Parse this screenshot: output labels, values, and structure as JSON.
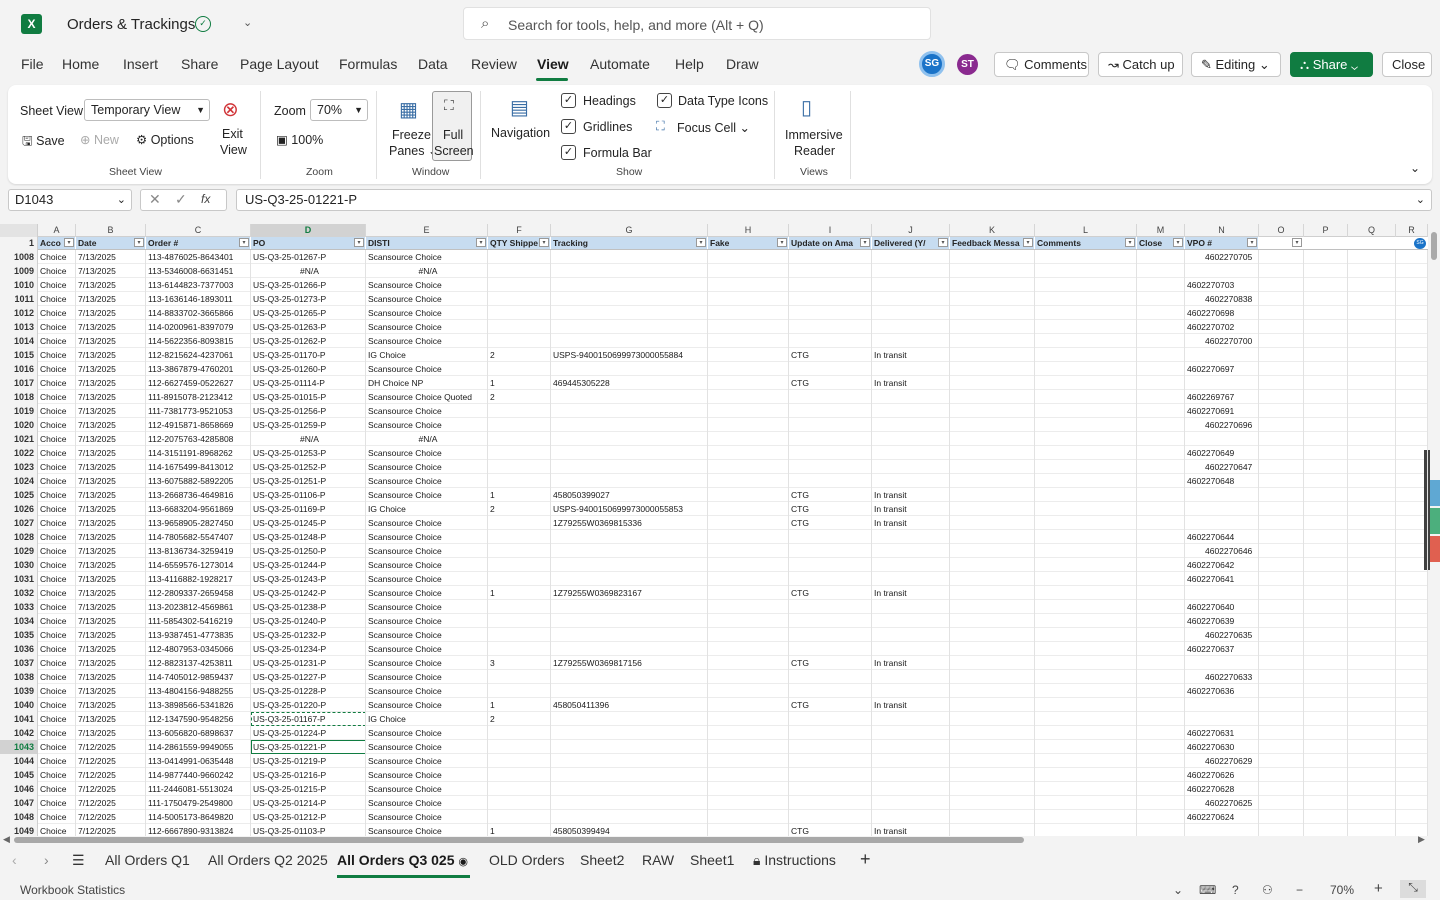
{
  "app": {
    "title": "Orders & Trackings",
    "logo": "X"
  },
  "search": {
    "placeholder": "Search for tools, help, and more (Alt + Q)"
  },
  "menu": [
    "File",
    "Home",
    "Insert",
    "Share",
    "Page Layout",
    "Formulas",
    "Data",
    "Review",
    "View",
    "Automate",
    "Help",
    "Draw"
  ],
  "active_menu": "View",
  "avatars": [
    "SG",
    "ST"
  ],
  "buttons": {
    "comments": "Comments",
    "catchup": "Catch up",
    "editing": "Editing",
    "share": "Share",
    "close": "Close"
  },
  "ribbon": {
    "sheet_view_label": "Sheet View",
    "sheet_view_value": "Temporary View",
    "save": "Save",
    "new": "New",
    "options": "Options",
    "exit": "Exit",
    "exit2": "View",
    "group_sheet_view": "Sheet View",
    "zoom_label": "Zoom",
    "zoom_value": "70%",
    "zoom_100": "100%",
    "group_zoom": "Zoom",
    "freeze": "Freeze",
    "freeze2": "Panes",
    "full": "Full",
    "full2": "Screen",
    "group_window": "Window",
    "navigation": "Navigation",
    "headings": "Headings",
    "gridlines": "Gridlines",
    "formula_bar": "Formula Bar",
    "data_type_icons": "Data Type Icons",
    "focus_cell": "Focus Cell",
    "group_show": "Show",
    "immersive": "Immersive",
    "reader": "Reader",
    "group_views": "Views"
  },
  "formula": {
    "name_box": "D1043",
    "value": "US-Q3-25-01221-P"
  },
  "columns": [
    "A",
    "B",
    "C",
    "D",
    "E",
    "F",
    "G",
    "H",
    "I",
    "J",
    "K",
    "L",
    "M",
    "N",
    "O",
    "P",
    "Q",
    "R"
  ],
  "header_cells": [
    "Acco",
    "Date",
    "Order #",
    "PO",
    "DISTI",
    "QTY Shippe",
    "Tracking",
    "Fake",
    "Update on Ama",
    "Delivered (Y/",
    "Feedback Messa",
    "Comments",
    "Close",
    "VPO #",
    "",
    "",
    "",
    ""
  ],
  "rows": [
    [
      "1008",
      "Choice",
      "7/13/2025",
      "113-4876025-8643401",
      "US-Q3-25-01267-P",
      "Scansource Choice",
      "",
      "",
      "",
      "",
      "",
      "",
      "",
      "",
      "4602270705"
    ],
    [
      "1009",
      "Choice",
      "7/13/2025",
      "113-5346008-6631451",
      "#N/A",
      "#N/A",
      "",
      "",
      "",
      "",
      "",
      "",
      "",
      "",
      ""
    ],
    [
      "1010",
      "Choice",
      "7/13/2025",
      "113-6144823-7377003",
      "US-Q3-25-01266-P",
      "Scansource Choice",
      "",
      "",
      "",
      "",
      "",
      "",
      "",
      "",
      "4602270703"
    ],
    [
      "1011",
      "Choice",
      "7/13/2025",
      "113-1636146-1893011",
      "US-Q3-25-01273-P",
      "Scansource Choice",
      "",
      "",
      "",
      "",
      "",
      "",
      "",
      "",
      "4602270838"
    ],
    [
      "1012",
      "Choice",
      "7/13/2025",
      "114-8833702-3665866",
      "US-Q3-25-01265-P",
      "Scansource Choice",
      "",
      "",
      "",
      "",
      "",
      "",
      "",
      "",
      "4602270698"
    ],
    [
      "1013",
      "Choice",
      "7/13/2025",
      "114-0200961-8397079",
      "US-Q3-25-01263-P",
      "Scansource Choice",
      "",
      "",
      "",
      "",
      "",
      "",
      "",
      "",
      "4602270702"
    ],
    [
      "1014",
      "Choice",
      "7/13/2025",
      "114-5622356-8093815",
      "US-Q3-25-01262-P",
      "Scansource Choice",
      "",
      "",
      "",
      "",
      "",
      "",
      "",
      "",
      "4602270700"
    ],
    [
      "1015",
      "Choice",
      "7/13/2025",
      "112-8215624-4237061",
      "US-Q3-25-01170-P",
      "IG Choice",
      "2",
      "USPS-9400150699973000055884",
      "",
      "CTG",
      "In transit",
      "",
      "",
      "",
      ""
    ],
    [
      "1016",
      "Choice",
      "7/13/2025",
      "113-3867879-4760201",
      "US-Q3-25-01260-P",
      "Scansource Choice",
      "",
      "",
      "",
      "",
      "",
      "",
      "",
      "",
      "4602270697"
    ],
    [
      "1017",
      "Choice",
      "7/13/2025",
      "112-6627459-0522627",
      "US-Q3-25-01114-P",
      "DH Choice NP",
      "1",
      "469445305228",
      "",
      "CTG",
      "In transit",
      "",
      "",
      "",
      ""
    ],
    [
      "1018",
      "Choice",
      "7/13/2025",
      "111-8915078-2123412",
      "US-Q3-25-01015-P",
      "Scansource Choice Quoted",
      "2",
      "",
      "",
      "",
      "",
      "",
      "",
      "",
      "4602269767"
    ],
    [
      "1019",
      "Choice",
      "7/13/2025",
      "111-7381773-9521053",
      "US-Q3-25-01256-P",
      "Scansource Choice",
      "",
      "",
      "",
      "",
      "",
      "",
      "",
      "",
      "4602270691"
    ],
    [
      "1020",
      "Choice",
      "7/13/2025",
      "112-4915871-8658669",
      "US-Q3-25-01259-P",
      "Scansource Choice",
      "",
      "",
      "",
      "",
      "",
      "",
      "",
      "",
      "4602270696"
    ],
    [
      "1021",
      "Choice",
      "7/13/2025",
      "112-2075763-4285808",
      "#N/A",
      "#N/A",
      "",
      "",
      "",
      "",
      "",
      "",
      "",
      "",
      ""
    ],
    [
      "1022",
      "Choice",
      "7/13/2025",
      "114-3151191-8968262",
      "US-Q3-25-01253-P",
      "Scansource Choice",
      "",
      "",
      "",
      "",
      "",
      "",
      "",
      "",
      "4602270649"
    ],
    [
      "1023",
      "Choice",
      "7/13/2025",
      "114-1675499-8413012",
      "US-Q3-25-01252-P",
      "Scansource Choice",
      "",
      "",
      "",
      "",
      "",
      "",
      "",
      "",
      "4602270647"
    ],
    [
      "1024",
      "Choice",
      "7/13/2025",
      "113-6075882-5892205",
      "US-Q3-25-01251-P",
      "Scansource Choice",
      "",
      "",
      "",
      "",
      "",
      "",
      "",
      "",
      "4602270648"
    ],
    [
      "1025",
      "Choice",
      "7/13/2025",
      "113-2668736-4649816",
      "US-Q3-25-01106-P",
      "Scansource Choice",
      "1",
      "458050399027",
      "",
      "CTG",
      "In transit",
      "",
      "",
      "",
      ""
    ],
    [
      "1026",
      "Choice",
      "7/13/2025",
      "113-6683204-9561869",
      "US-Q3-25-01169-P",
      "IG Choice",
      "2",
      "USPS-9400150699973000055853",
      "",
      "CTG",
      "In transit",
      "",
      "",
      "",
      ""
    ],
    [
      "1027",
      "Choice",
      "7/13/2025",
      "113-9658905-2827450",
      "US-Q3-25-01245-P",
      "Scansource Choice",
      "",
      "1Z79255W0369815336",
      "",
      "CTG",
      "In transit",
      "",
      "",
      "",
      ""
    ],
    [
      "1028",
      "Choice",
      "7/13/2025",
      "114-7805682-5547407",
      "US-Q3-25-01248-P",
      "Scansource Choice",
      "",
      "",
      "",
      "",
      "",
      "",
      "",
      "",
      "4602270644"
    ],
    [
      "1029",
      "Choice",
      "7/13/2025",
      "113-8136734-3259419",
      "US-Q3-25-01250-P",
      "Scansource Choice",
      "",
      "",
      "",
      "",
      "",
      "",
      "",
      "",
      "4602270646"
    ],
    [
      "1030",
      "Choice",
      "7/13/2025",
      "114-6559576-1273014",
      "US-Q3-25-01244-P",
      "Scansource Choice",
      "",
      "",
      "",
      "",
      "",
      "",
      "",
      "",
      "4602270642"
    ],
    [
      "1031",
      "Choice",
      "7/13/2025",
      "113-4116882-1928217",
      "US-Q3-25-01243-P",
      "Scansource Choice",
      "",
      "",
      "",
      "",
      "",
      "",
      "",
      "",
      "4602270641"
    ],
    [
      "1032",
      "Choice",
      "7/13/2025",
      "112-2809337-2659458",
      "US-Q3-25-01242-P",
      "Scansource Choice",
      "1",
      "1Z79255W0369823167",
      "",
      "CTG",
      "In transit",
      "",
      "",
      "",
      ""
    ],
    [
      "1033",
      "Choice",
      "7/13/2025",
      "113-2023812-4569861",
      "US-Q3-25-01238-P",
      "Scansource Choice",
      "",
      "",
      "",
      "",
      "",
      "",
      "",
      "",
      "4602270640"
    ],
    [
      "1034",
      "Choice",
      "7/13/2025",
      "111-5854302-5416219",
      "US-Q3-25-01240-P",
      "Scansource Choice",
      "",
      "",
      "",
      "",
      "",
      "",
      "",
      "",
      "4602270639"
    ],
    [
      "1035",
      "Choice",
      "7/13/2025",
      "113-9387451-4773835",
      "US-Q3-25-01232-P",
      "Scansource Choice",
      "",
      "",
      "",
      "",
      "",
      "",
      "",
      "",
      "4602270635"
    ],
    [
      "1036",
      "Choice",
      "7/13/2025",
      "112-4807953-0345066",
      "US-Q3-25-01234-P",
      "Scansource Choice",
      "",
      "",
      "",
      "",
      "",
      "",
      "",
      "",
      "4602270637"
    ],
    [
      "1037",
      "Choice",
      "7/13/2025",
      "112-8823137-4253811",
      "US-Q3-25-01231-P",
      "Scansource Choice",
      "3",
      "1Z79255W0369817156",
      "",
      "CTG",
      "In transit",
      "",
      "",
      "",
      ""
    ],
    [
      "1038",
      "Choice",
      "7/13/2025",
      "114-7405012-9859437",
      "US-Q3-25-01227-P",
      "Scansource Choice",
      "",
      "",
      "",
      "",
      "",
      "",
      "",
      "",
      "4602270633"
    ],
    [
      "1039",
      "Choice",
      "7/13/2025",
      "113-4804156-9488255",
      "US-Q3-25-01228-P",
      "Scansource Choice",
      "",
      "",
      "",
      "",
      "",
      "",
      "",
      "",
      "4602270636"
    ],
    [
      "1040",
      "Choice",
      "7/13/2025",
      "113-3898566-5341826",
      "US-Q3-25-01220-P",
      "Scansource Choice",
      "1",
      "458050411396",
      "",
      "CTG",
      "In transit",
      "",
      "",
      "",
      ""
    ],
    [
      "1041",
      "Choice",
      "7/13/2025",
      "112-1347590-9548256",
      "US-Q3-25-01167-P",
      "IG Choice",
      "2",
      "",
      "",
      "",
      "",
      "",
      "",
      "",
      ""
    ],
    [
      "1042",
      "Choice",
      "7/13/2025",
      "113-6056820-6898637",
      "US-Q3-25-01224-P",
      "Scansource Choice",
      "",
      "",
      "",
      "",
      "",
      "",
      "",
      "",
      "4602270631"
    ],
    [
      "1043",
      "Choice",
      "7/12/2025",
      "114-2861559-9949055",
      "US-Q3-25-01221-P",
      "Scansource Choice",
      "",
      "",
      "",
      "",
      "",
      "",
      "",
      "",
      "4602270630"
    ],
    [
      "1044",
      "Choice",
      "7/12/2025",
      "113-0414991-0635448",
      "US-Q3-25-01219-P",
      "Scansource Choice",
      "",
      "",
      "",
      "",
      "",
      "",
      "",
      "",
      "4602270629"
    ],
    [
      "1045",
      "Choice",
      "7/12/2025",
      "114-9877440-9660242",
      "US-Q3-25-01216-P",
      "Scansource Choice",
      "",
      "",
      "",
      "",
      "",
      "",
      "",
      "",
      "4602270626"
    ],
    [
      "1046",
      "Choice",
      "7/12/2025",
      "111-2446081-5513024",
      "US-Q3-25-01215-P",
      "Scansource Choice",
      "",
      "",
      "",
      "",
      "",
      "",
      "",
      "",
      "4602270628"
    ],
    [
      "1047",
      "Choice",
      "7/12/2025",
      "111-1750479-2549800",
      "US-Q3-25-01214-P",
      "Scansource Choice",
      "",
      "",
      "",
      "",
      "",
      "",
      "",
      "",
      "4602270625"
    ],
    [
      "1048",
      "Choice",
      "7/12/2025",
      "114-5005173-8649820",
      "US-Q3-25-01212-P",
      "Scansource Choice",
      "",
      "",
      "",
      "",
      "",
      "",
      "",
      "",
      "4602270624"
    ],
    [
      "1049",
      "Choice",
      "7/12/2025",
      "112-6667890-9313824",
      "US-Q3-25-01103-P",
      "Scansource Choice",
      "1",
      "458050399494",
      "",
      "CTG",
      "In transit",
      "",
      "",
      "",
      ""
    ]
  ],
  "selected_row": "1043",
  "selected_col": "D",
  "sheets": [
    "All Orders Q1",
    "All Orders Q2 2025",
    "All Orders Q3 025",
    "OLD Orders",
    "Sheet2",
    "RAW",
    "Sheet1",
    "Instructions"
  ],
  "active_sheet": "All Orders Q3 025",
  "status": {
    "left": "Workbook Statistics",
    "zoom": "70%"
  },
  "colors": {
    "accent": "#107c41",
    "header_fill": "#c7dcf0"
  }
}
